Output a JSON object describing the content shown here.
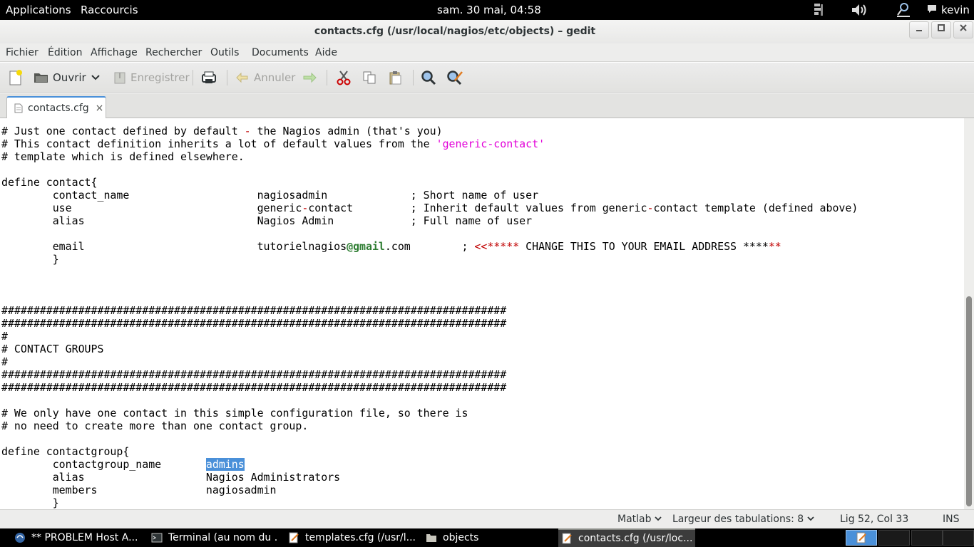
{
  "top_panel": {
    "applications": "Applications",
    "shortcuts": "Raccourcis",
    "clock": "sam. 30 mai, 04:58",
    "user": "kevin"
  },
  "window": {
    "title": "contacts.cfg (/usr/local/nagios/etc/objects) – gedit"
  },
  "menubar": [
    "Fichier",
    "Édition",
    "Affichage",
    "Rechercher",
    "Outils",
    "Documents",
    "Aide"
  ],
  "toolbar": {
    "open_label": "Ouvrir",
    "save_label": "Enregistrer",
    "undo_label": "Annuler"
  },
  "tab": {
    "label": "contacts.cfg",
    "close": "×"
  },
  "editor": {
    "lines": [
      "# Just one contact defined by default - the Nagios admin (that's you)",
      "# This contact definition inherits a lot of default values from the 'generic-contact'",
      "# template which is defined elsewhere.",
      "",
      "define contact{",
      "        contact_name                    nagiosadmin             ; Short name of user",
      "        use                             generic-contact         ; Inherit default values from generic-contact template (defined above)",
      "        alias                           Nagios Admin            ; Full name of user",
      "",
      "        email                           tutorielnagios@gmail.com        ; <<***** CHANGE THIS TO YOUR EMAIL ADDRESS ******",
      "        }",
      "",
      "",
      "",
      "###############################################################################",
      "###############################################################################",
      "#",
      "# CONTACT GROUPS",
      "#",
      "###############################################################################",
      "###############################################################################",
      "",
      "# We only have one contact in this simple configuration file, so there is",
      "# no need to create more than one contact group.",
      "",
      "define contactgroup{",
      "        contactgroup_name       admins",
      "        alias                   Nagios Administrators",
      "        members                 nagiosadmin",
      "        }"
    ]
  },
  "statusbar": {
    "language": "Matlab",
    "tab_width": "Largeur des tabulations:  8",
    "position": "Lig 52, Col 33",
    "mode": "INS"
  },
  "taskbar": [
    "** PROBLEM Host A...",
    "Terminal (au nom du ...",
    "templates.cfg (/usr/l...",
    "objects",
    "contacts.cfg (/usr/loc..."
  ],
  "colors": {
    "selection": "#4a90d9",
    "string": "#e200d8",
    "operator": "#c00000",
    "email_highlight": "#2e7d32"
  }
}
